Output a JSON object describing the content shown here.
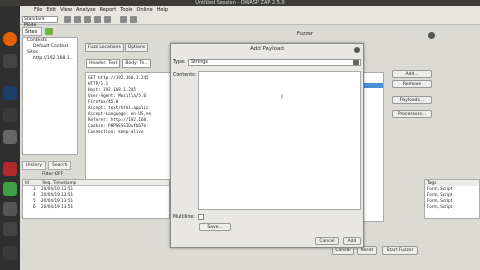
{
  "window": {
    "title": "Untitled Session - OWASP ZAP 2.5.0"
  },
  "menu": [
    "File",
    "Edit",
    "View",
    "Analyse",
    "Report",
    "Tools",
    "Online",
    "Help"
  ],
  "toolbar": {
    "mode": "Standard Mode"
  },
  "sites": {
    "tab_label": "Sites",
    "tree": [
      "Contexts",
      "Default Context",
      "Sites",
      "http://192.168.1..."
    ]
  },
  "fuzzer": {
    "title": "Fuzzer",
    "tabs": [
      "Fuzz Locations",
      "Options",
      "Message Processors"
    ],
    "subtabs": [
      "Header: Text",
      "Body: Te..."
    ],
    "request_lines": [
      "GET http://192.168.1.245",
      "HTTP/1.1",
      "Host: 192.168.1.245",
      "User-Agent: Mozilla/5.0",
      "Firefox/45.0",
      "Accept: text/html,applic",
      "Accept-Language: en-US,en",
      "Referer: http://192.168.",
      "Cookie: PHPSESSID=fb67e",
      "Connection: keep-alive"
    ],
    "side_buttons": {
      "add": "Add...",
      "remove": "Remove",
      "payloads": "Payloads...",
      "processors": "Processors..."
    },
    "bottom_buttons": {
      "cancel": "Cancel",
      "reset": "Reset",
      "start": "Start Fuzzer"
    }
  },
  "history": {
    "tab_label": "History",
    "search_tab_label": "Search",
    "filter": "Filter:OFF",
    "columns": [
      "Id",
      "Req. Timestamp"
    ],
    "rows": [
      {
        "id": "3",
        "ts": "20/04/19 13:51"
      },
      {
        "id": "4",
        "ts": "20/04/19 13:51"
      },
      {
        "id": "5",
        "ts": "20/04/19 13:51"
      },
      {
        "id": "6",
        "ts": "20/04/19 13:51"
      }
    ],
    "tags_header": "Tags",
    "tags": [
      "Form, Script",
      "Form, Script",
      "Form, Script",
      "Form, Script"
    ]
  },
  "dialog": {
    "title": "Add Payload",
    "type_label": "Type:",
    "type_value": "Strings",
    "contents_label": "Contents:",
    "multiline_label": "Multiline:",
    "save_label": "Save...",
    "cancel_label": "Cancel",
    "add_label": "Add"
  }
}
